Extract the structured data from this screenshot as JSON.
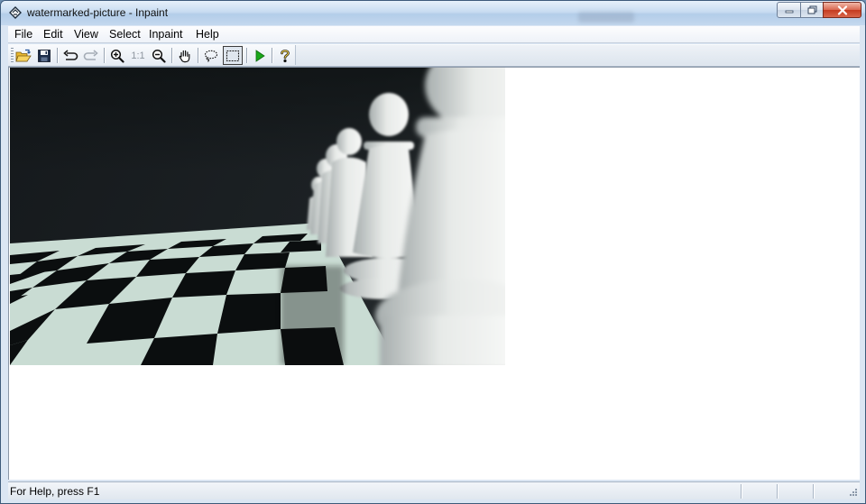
{
  "window": {
    "title": "watermarked-picture - Inpaint",
    "app_icon": "inpaint-app-icon",
    "controls": [
      "minimize-icon",
      "maximize-icon",
      "close-icon"
    ]
  },
  "menubar": {
    "items": [
      {
        "label": "File"
      },
      {
        "label": "Edit"
      },
      {
        "label": "View"
      },
      {
        "label": "Select"
      },
      {
        "label": "Inpaint"
      },
      {
        "label": "Help"
      }
    ]
  },
  "toolbar": {
    "buttons": [
      {
        "icon": "open-folder-icon"
      },
      {
        "icon": "save-icon"
      },
      {
        "icon": "undo-icon"
      },
      {
        "icon": "redo-icon"
      },
      {
        "icon": "zoom-in-icon"
      },
      {
        "icon": "actual-size-icon",
        "label": "1:1"
      },
      {
        "icon": "zoom-out-icon"
      },
      {
        "icon": "hand-pan-icon"
      },
      {
        "icon": "lasso-select-icon"
      },
      {
        "icon": "rect-select-icon",
        "active": true
      },
      {
        "icon": "run-inpaint-icon"
      },
      {
        "icon": "help-icon"
      }
    ]
  },
  "canvas": {
    "image_subject": "chess-pawns-on-board-photo"
  },
  "statusbar": {
    "text": "For Help, press F1"
  },
  "colors": {
    "accent_green": "#1aa81a",
    "folder_yellow": "#e8b830",
    "board_light": "#cfe0d8",
    "board_dark": "#0c0f10",
    "pawn_white": "#eef0ee"
  }
}
